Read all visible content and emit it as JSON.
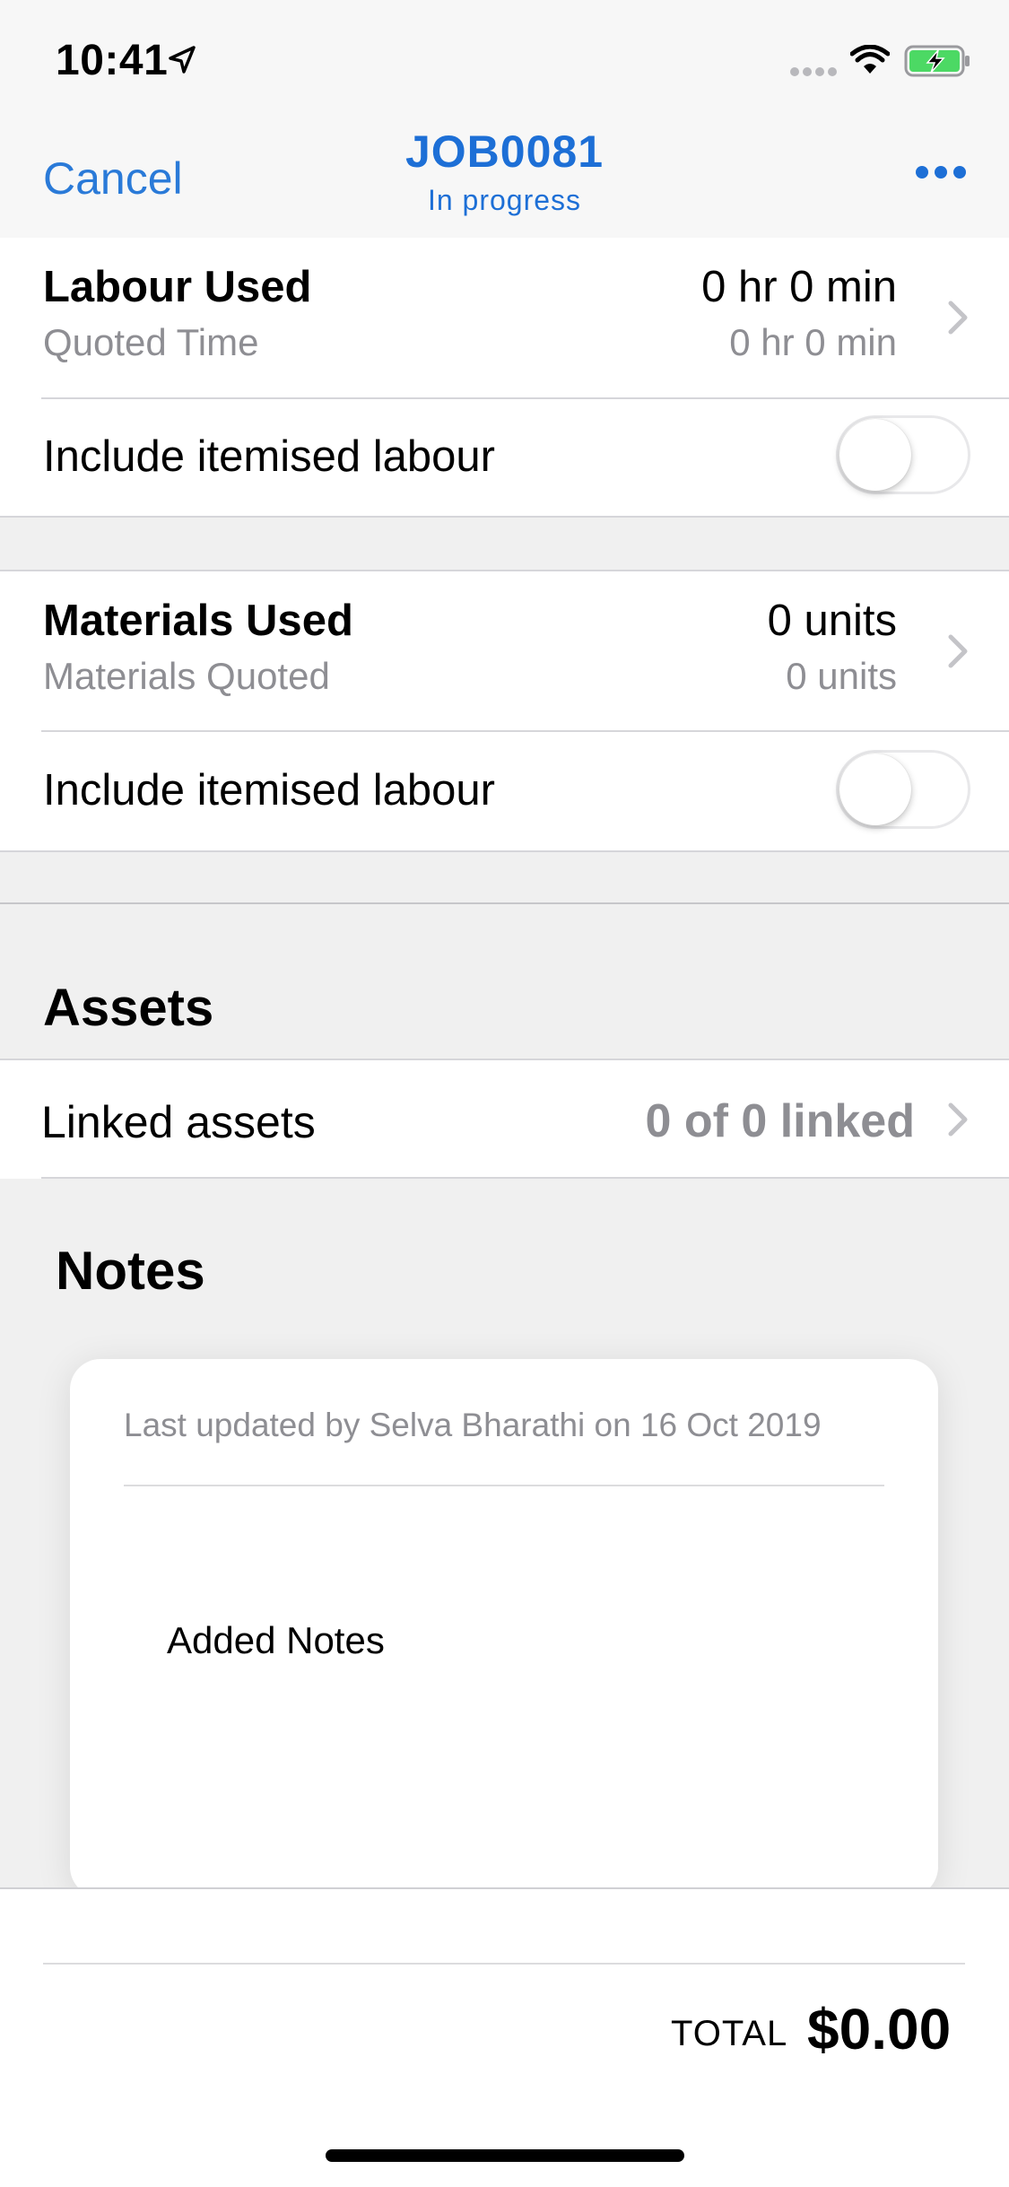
{
  "status_bar": {
    "time": "10:41"
  },
  "nav": {
    "cancel_label": "Cancel",
    "title": "JOB0081",
    "subtitle": "In progress",
    "more_icon": "ellipsis-icon"
  },
  "labour": {
    "title": "Labour Used",
    "subtitle": "Quoted Time",
    "value": "0 hr 0 min",
    "quoted_value": "0 hr 0 min",
    "toggle_label": "Include itemised labour",
    "toggle_on": false
  },
  "materials": {
    "title": "Materials Used",
    "subtitle": "Materials Quoted",
    "value": "0 units",
    "quoted_value": "0 units",
    "toggle_label": "Include itemised labour",
    "toggle_on": false
  },
  "assets": {
    "header": "Assets",
    "linked_label": "Linked assets",
    "linked_value": "0 of 0 linked"
  },
  "notes": {
    "title": "Notes",
    "meta": "Last updated by Selva Bharathi on 16 Oct 2019",
    "text": "Added Notes"
  },
  "footer": {
    "total_label": "TOTAL",
    "total_value": "$0.00"
  },
  "colors": {
    "accent": "#1d6fd6",
    "secondary_text": "#8e8e93",
    "battery_green": "#4cd964"
  }
}
